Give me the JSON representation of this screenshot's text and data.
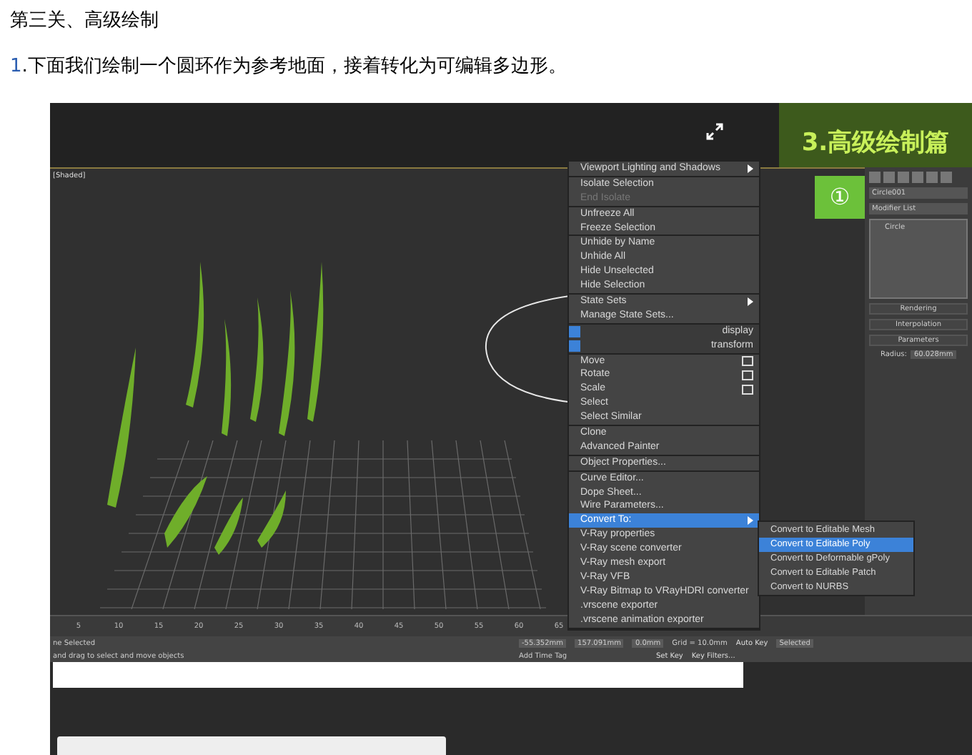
{
  "heading": "第三关、高级绘制",
  "step": {
    "number": "1",
    "text": ".下面我们绘制一个圆环作为参考地面，接着转化为可编辑多边形。"
  },
  "banner": {
    "title": "3.高级绘制篇"
  },
  "step_marker": "①",
  "viewport": {
    "label": "[Shaded]"
  },
  "context_menu": [
    [
      {
        "label": "Viewport Lighting and Shadows",
        "kind": "submenu",
        "selected": false
      }
    ],
    [
      {
        "label": "Isolate Selection",
        "kind": "normal",
        "selected": false
      },
      {
        "label": "End Isolate",
        "kind": "disabled",
        "selected": false
      }
    ],
    [
      {
        "label": "Unfreeze All",
        "kind": "normal",
        "selected": false
      },
      {
        "label": "Freeze Selection",
        "kind": "normal",
        "selected": false
      }
    ],
    [
      {
        "label": "Unhide by Name",
        "kind": "normal",
        "selected": false
      },
      {
        "label": "Unhide All",
        "kind": "normal",
        "selected": false
      },
      {
        "label": "Hide Unselected",
        "kind": "normal",
        "selected": false
      },
      {
        "label": "Hide Selection",
        "kind": "normal",
        "selected": false
      }
    ],
    [
      {
        "label": "State Sets",
        "kind": "submenu",
        "selected": false
      },
      {
        "label": "Manage State Sets...",
        "kind": "normal",
        "selected": false
      }
    ],
    [
      {
        "label": "display",
        "kind": "quad",
        "selected": false
      },
      {
        "label": "transform",
        "kind": "quad",
        "selected": false
      }
    ],
    [
      {
        "label": "Move",
        "kind": "box",
        "selected": false
      },
      {
        "label": "Rotate",
        "kind": "box",
        "selected": false
      },
      {
        "label": "Scale",
        "kind": "box",
        "selected": false
      },
      {
        "label": "Select",
        "kind": "normal",
        "selected": false
      },
      {
        "label": "Select Similar",
        "kind": "normal",
        "selected": false
      }
    ],
    [
      {
        "label": "Clone",
        "kind": "normal",
        "selected": false
      },
      {
        "label": "Advanced Painter",
        "kind": "normal",
        "selected": false
      }
    ],
    [
      {
        "label": "Object Properties...",
        "kind": "normal",
        "selected": false
      }
    ],
    [
      {
        "label": "Curve Editor...",
        "kind": "normal",
        "selected": false
      },
      {
        "label": "Dope Sheet...",
        "kind": "normal",
        "selected": false
      },
      {
        "label": "Wire Parameters...",
        "kind": "normal",
        "selected": false
      },
      {
        "label": "Convert To:",
        "kind": "submenu",
        "selected": true
      },
      {
        "label": "V-Ray properties",
        "kind": "normal",
        "selected": false
      },
      {
        "label": "V-Ray scene converter",
        "kind": "normal",
        "selected": false
      },
      {
        "label": "V-Ray mesh export",
        "kind": "normal",
        "selected": false
      },
      {
        "label": "V-Ray VFB",
        "kind": "normal",
        "selected": false
      },
      {
        "label": "V-Ray Bitmap to VRayHDRI converter",
        "kind": "normal",
        "selected": false
      },
      {
        "label": ".vrscene exporter",
        "kind": "normal",
        "selected": false
      },
      {
        "label": ".vrscene animation exporter",
        "kind": "normal",
        "selected": false
      }
    ]
  ],
  "submenu": [
    {
      "label": "Convert to Editable Mesh",
      "selected": false
    },
    {
      "label": "Convert to Editable Poly",
      "selected": true
    },
    {
      "label": "Convert to Deformable gPoly",
      "selected": false
    },
    {
      "label": "Convert to Editable Patch",
      "selected": false
    },
    {
      "label": "Convert to NURBS",
      "selected": false
    }
  ],
  "command_panel": {
    "object_name": "Circle001",
    "modifier_list": "Modifier List",
    "stack": [
      "Circle"
    ],
    "rollouts": [
      "Rendering",
      "Interpolation",
      "Parameters"
    ],
    "radius_label": "Radius:",
    "radius_value": "60.028mm"
  },
  "timeline": {
    "ticks": [
      "5",
      "10",
      "15",
      "20",
      "25",
      "30",
      "35",
      "40",
      "45",
      "50",
      "55",
      "60",
      "65"
    ]
  },
  "status_bar": {
    "selection": "ne Selected",
    "prompt": "and drag to select and move objects",
    "x": "-55.352mm",
    "y": "157.091mm",
    "z": "0.0mm",
    "grid": "Grid = 10.0mm",
    "time_tag": "Add Time Tag",
    "auto_key": "Auto Key",
    "selected_set": "Selected",
    "set_key": "Set Key",
    "key_filters": "Key Filters..."
  }
}
